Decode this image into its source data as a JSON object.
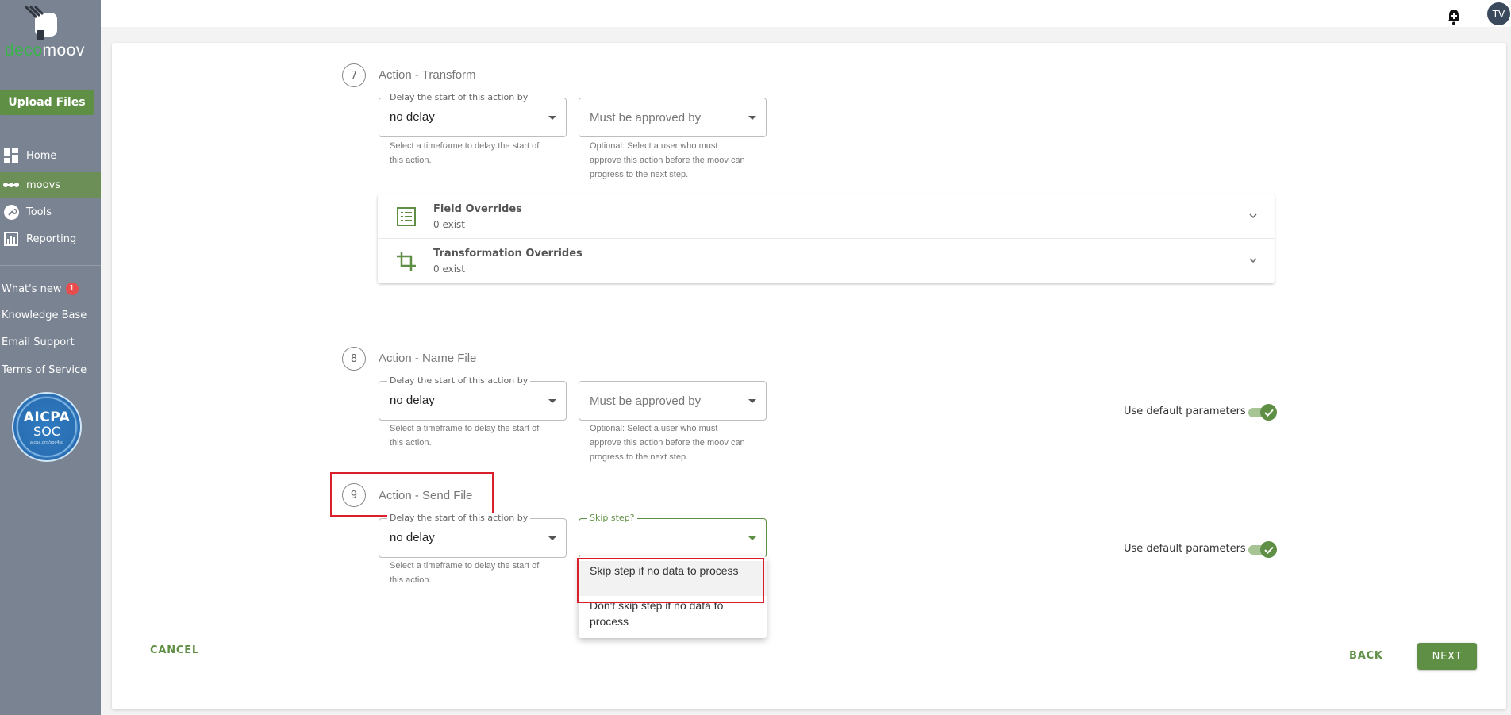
{
  "brand": {
    "logo_green": "deco",
    "logo_white": "moov",
    "accent": "#5e8f44"
  },
  "sidebar": {
    "upload_label": "Upload Files",
    "nav": [
      {
        "label": "Home",
        "icon": "dashboard-icon"
      },
      {
        "label": "moovs",
        "icon": "dots-icon",
        "active": true
      },
      {
        "label": "Tools",
        "icon": "wrench-icon"
      },
      {
        "label": "Reporting",
        "icon": "bar-chart-icon"
      }
    ],
    "links": [
      {
        "label": "What's new",
        "badge": "1"
      },
      {
        "label": "Knowledge Base"
      },
      {
        "label": "Email Support"
      },
      {
        "label": "Terms of Service"
      }
    ],
    "aicpa": {
      "line1": "AICPA",
      "line2": "SOC",
      "line3": "aicpa.org/soc4so"
    }
  },
  "topbar": {
    "avatar_initials": "TV"
  },
  "steps": [
    {
      "number": "7",
      "title": "Action - Transform",
      "delay_legend": "Delay the start of this action by",
      "delay_value": "no delay",
      "delay_helper": "Select a timeframe to delay the start of this action.",
      "approve_placeholder": "Must be approved by",
      "approve_helper": "Optional: Select a user who must approve this action before the moov can progress to the next step.",
      "overrides": [
        {
          "title": "Field Overrides",
          "sub": "0 exist",
          "icon": "list-icon"
        },
        {
          "title": "Transformation Overrides",
          "sub": "0 exist",
          "icon": "crop-icon"
        }
      ]
    },
    {
      "number": "8",
      "title": "Action - Name File",
      "delay_legend": "Delay the start of this action by",
      "delay_value": "no delay",
      "delay_helper": "Select a timeframe to delay the start of this action.",
      "approve_placeholder": "Must be approved by",
      "approve_helper": "Optional: Select a user who must approve this action before the moov can progress to the next step.",
      "toggle_label": "Use default parameters"
    },
    {
      "number": "9",
      "title": "Action - Send File",
      "delay_legend": "Delay the start of this action by",
      "delay_value": "no delay",
      "delay_helper": "Select a timeframe to delay the start of this action.",
      "skip_legend": "Skip step?",
      "toggle_label": "Use default parameters",
      "skip_options": [
        "Skip step if no data to process",
        "Don't skip step if no data to process"
      ]
    }
  ],
  "footer": {
    "cancel": "CANCEL",
    "back": "BACK",
    "next": "NEXT"
  }
}
